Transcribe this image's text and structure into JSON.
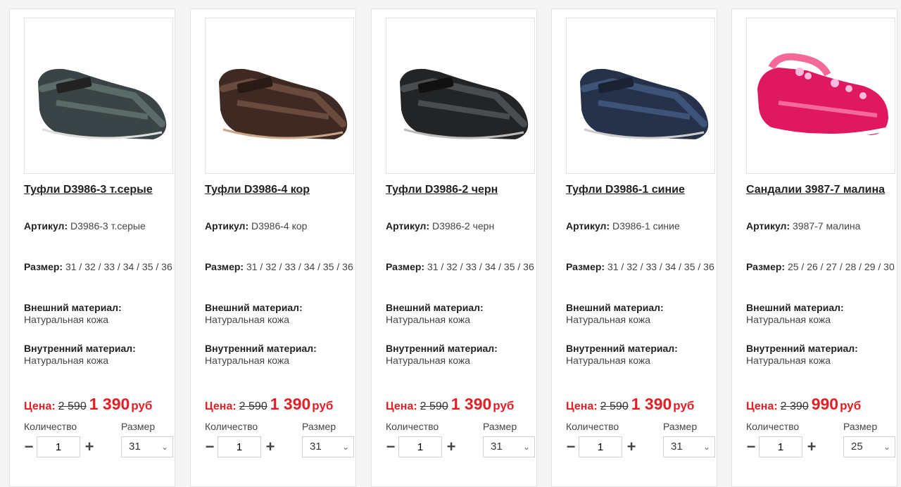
{
  "labels": {
    "article": "Артикул:",
    "size": "Размер:",
    "outer": "Внешний материал:",
    "inner": "Внутренний материал:",
    "price": "Цена:",
    "currency": "руб",
    "quantity": "Количество",
    "size_select": "Размер",
    "minus": "−",
    "plus": "+",
    "chevron": "⌄"
  },
  "products": [
    {
      "title": "Туфли D3986-3 т.серые",
      "article": "D3986-3 т.серые",
      "sizes": "31 / 32 / 33 / 34 / 35 / 36",
      "outer": "Натуральная кожа",
      "inner": "Натуральная кожа",
      "old_price": "2 590",
      "new_price": "1 390",
      "qty": "1",
      "size_selected": "31",
      "shoe_color": "#3a4346",
      "accent_color": "#5b6b68"
    },
    {
      "title": "Туфли D3986-4 кор",
      "article": "D3986-4 кор",
      "sizes": "31 / 32 / 33 / 34 / 35 / 36",
      "outer": "Натуральная кожа",
      "inner": "Натуральная кожа",
      "old_price": "2 590",
      "new_price": "1 390",
      "qty": "1",
      "size_selected": "31",
      "shoe_color": "#3e2a22",
      "accent_color": "#6a4a3c"
    },
    {
      "title": "Туфли D3986-2 черн",
      "article": "D3986-2 черн",
      "sizes": "31 / 32 / 33 / 34 / 35 / 36",
      "outer": "Натуральная кожа",
      "inner": "Натуральная кожа",
      "old_price": "2 590",
      "new_price": "1 390",
      "qty": "1",
      "size_selected": "31",
      "shoe_color": "#222426",
      "accent_color": "#4a4c4e"
    },
    {
      "title": "Туфли D3986-1 синие",
      "article": "D3986-1 синие",
      "sizes": "31 / 32 / 33 / 34 / 35 / 36",
      "outer": "Натуральная кожа",
      "inner": "Натуральная кожа",
      "old_price": "2 590",
      "new_price": "1 390",
      "qty": "1",
      "size_selected": "31",
      "shoe_color": "#25324a",
      "accent_color": "#3e5378"
    },
    {
      "title": "Сандалии 3987-7 малина",
      "article": "3987-7 малина",
      "sizes": "25 / 26 / 27 / 28 / 29 / 30",
      "outer": "Натуральная кожа",
      "inner": "Натуральная кожа",
      "old_price": "2 390",
      "new_price": "990",
      "qty": "1",
      "size_selected": "25",
      "shoe_color": "#e0185f",
      "accent_color": "#f36a9a"
    }
  ]
}
